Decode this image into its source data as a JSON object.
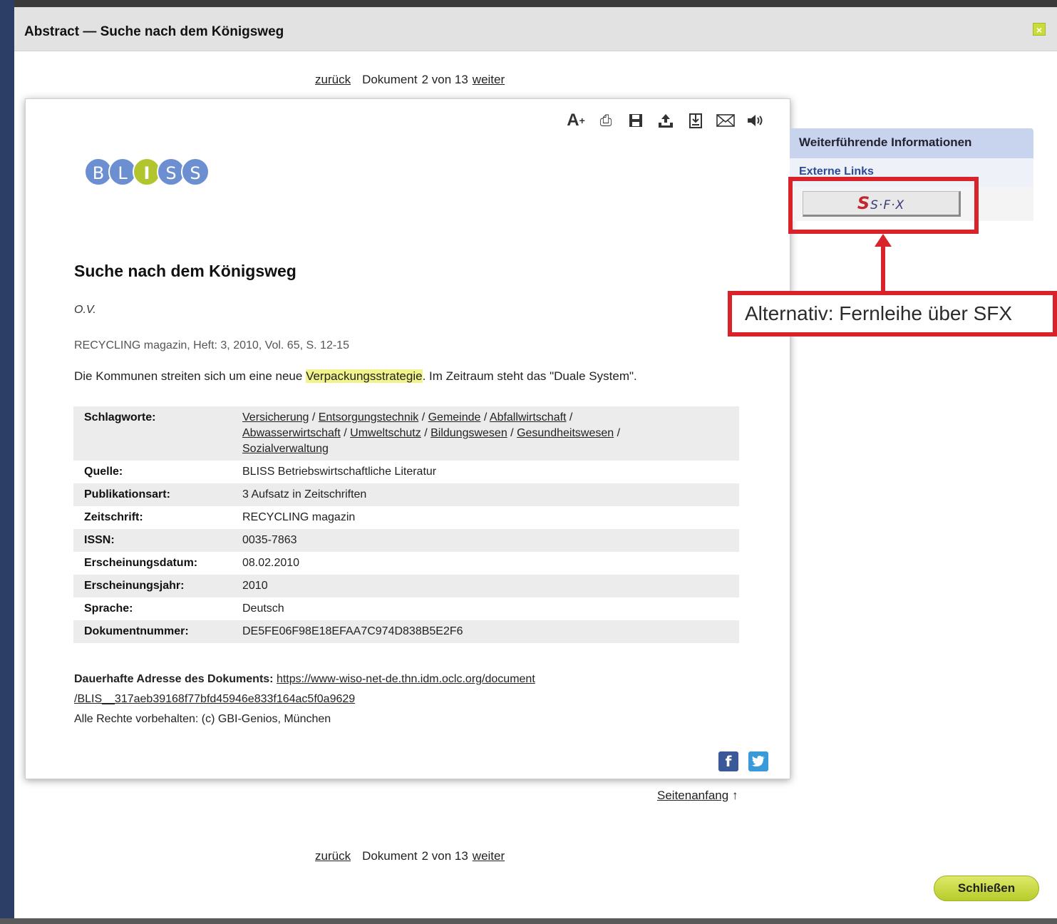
{
  "modal": {
    "title": "Abstract — Suche nach dem Königsweg",
    "close_icon": "×",
    "close_button": "Schließen"
  },
  "pager": {
    "prev": "zurück",
    "doc_label": "Dokument",
    "position": "2 von 13",
    "next": "weiter"
  },
  "toolbar": {
    "icons": [
      "font-size-increase-icon",
      "print-icon",
      "save-icon",
      "export-icon",
      "download-icon",
      "mail-icon",
      "speaker-icon"
    ]
  },
  "logo": {
    "letters": [
      "B",
      "L",
      "I",
      "S",
      "S"
    ]
  },
  "document": {
    "title": "Suche nach dem Königsweg",
    "author": "O.V.",
    "source": "RECYCLING magazin, Heft: 3, 2010, Vol. 65, S. 12-15",
    "abstract_before": "Die Kommunen streiten sich um eine neue ",
    "abstract_highlight": "Verpackungsstrategie",
    "abstract_after": ". Im Zeitraum steht das \"Duale System\"."
  },
  "meta": {
    "keywords_label": "Schlagworte:",
    "keywords": [
      "Versicherung",
      "Entsorgungstechnik",
      "Gemeinde",
      "Abfallwirtschaft",
      "Abwasserwirtschaft",
      "Umweltschutz",
      "Bildungswesen",
      "Gesundheitswesen",
      "Sozialverwaltung"
    ],
    "rows": [
      {
        "label": "Quelle:",
        "value": "BLISS Betriebswirtschaftliche Literatur"
      },
      {
        "label": "Publikationsart:",
        "value": "3 Aufsatz in Zeitschriften"
      },
      {
        "label": "Zeitschrift:",
        "value": "RECYCLING magazin"
      },
      {
        "label": "ISSN:",
        "value": "0035-7863"
      },
      {
        "label": "Erscheinungsdatum:",
        "value": "08.02.2010"
      },
      {
        "label": "Erscheinungsjahr:",
        "value": "2010"
      },
      {
        "label": "Sprache:",
        "value": "Deutsch"
      },
      {
        "label": "Dokumentnummer:",
        "value": "DE5FE06F98E18EFAA7C974D838B5E2F6"
      }
    ]
  },
  "permalink": {
    "label": "Dauerhafte Adresse des Dokuments:",
    "url_line1": "https://www-wiso-net-de.thn.idm.oclc.org/document",
    "url_line2": "/BLIS__317aeb39168f77bfd45946e833f164ac5f0a9629",
    "rights": "Alle Rechte vorbehalten: (c) GBI-Genios, München"
  },
  "share": {
    "facebook": "f",
    "twitter": "t"
  },
  "top_link": {
    "label": "Seitenanfang",
    "arrow": "↑"
  },
  "sidebar": {
    "heading": "Weiterführende Informationen",
    "subheading": "Externe Links",
    "sfx_s": "S",
    "sfx_text": "S·F·X"
  },
  "callout": {
    "text": "Alternativ: Fernleihe über SFX",
    "color": "#d8232a"
  }
}
